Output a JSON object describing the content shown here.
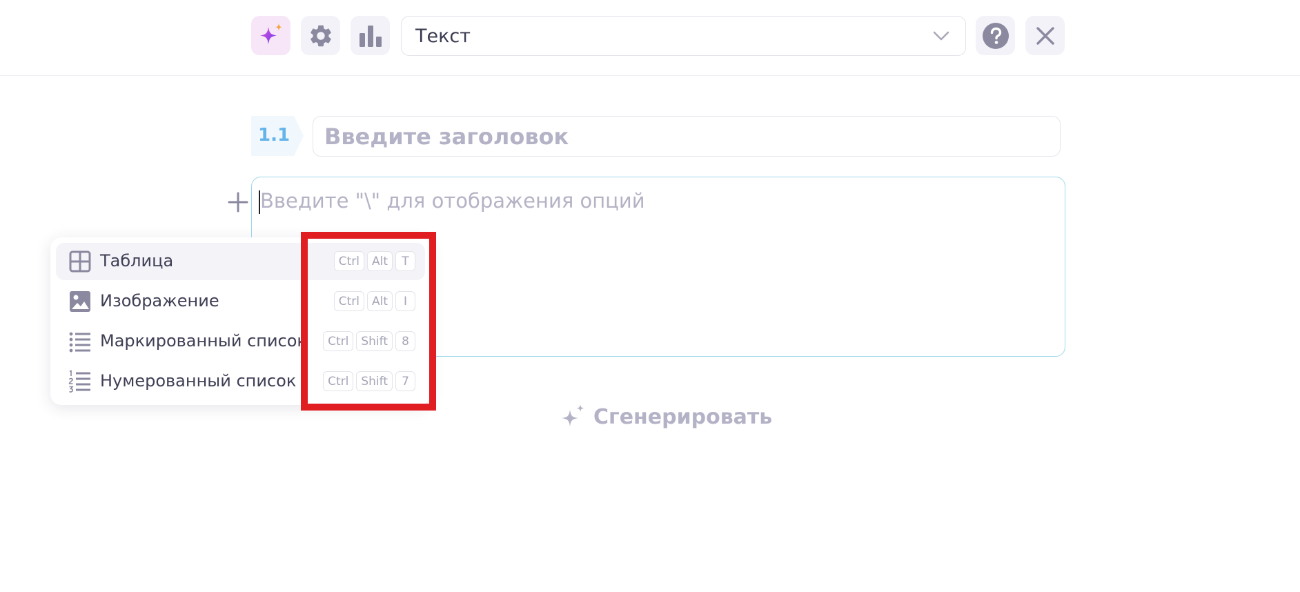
{
  "toolbar": {
    "ai_icon": "sparkles-gradient-icon",
    "settings_icon": "gear-icon",
    "stats_icon": "bar-chart-icon",
    "type_select": {
      "value": "Текст",
      "icon": "chevron-down-icon"
    },
    "help_icon": "question-circle-icon",
    "close_icon": "close-icon"
  },
  "section": {
    "number": "1.1",
    "title_placeholder": "Введите заголовок"
  },
  "editor": {
    "placeholder": "Введите \"\\\" для отображения опций",
    "add_icon": "plus-icon"
  },
  "block_menu": {
    "items": [
      {
        "label": "Таблица",
        "icon": "table-icon",
        "keys": [
          "Ctrl",
          "Alt",
          "T"
        ]
      },
      {
        "label": "Изображение",
        "icon": "image-icon",
        "keys": [
          "Ctrl",
          "Alt",
          "I"
        ]
      },
      {
        "label": "Маркированный список",
        "icon": "bulleted-list-icon",
        "keys": [
          "Ctrl",
          "Shift",
          "8"
        ]
      },
      {
        "label": "Нумерованный список",
        "icon": "numbered-list-icon",
        "keys": [
          "Ctrl",
          "Shift",
          "7"
        ]
      }
    ]
  },
  "generate": {
    "label": "Сгенерировать",
    "icon": "sparkles-icon"
  },
  "colors": {
    "accent_blue": "#64b4ea",
    "editor_border": "#9fd8ec",
    "highlight_red": "#e01e22",
    "placeholder_text": "#b3b2c6",
    "icon_gray": "#8a89a0"
  }
}
